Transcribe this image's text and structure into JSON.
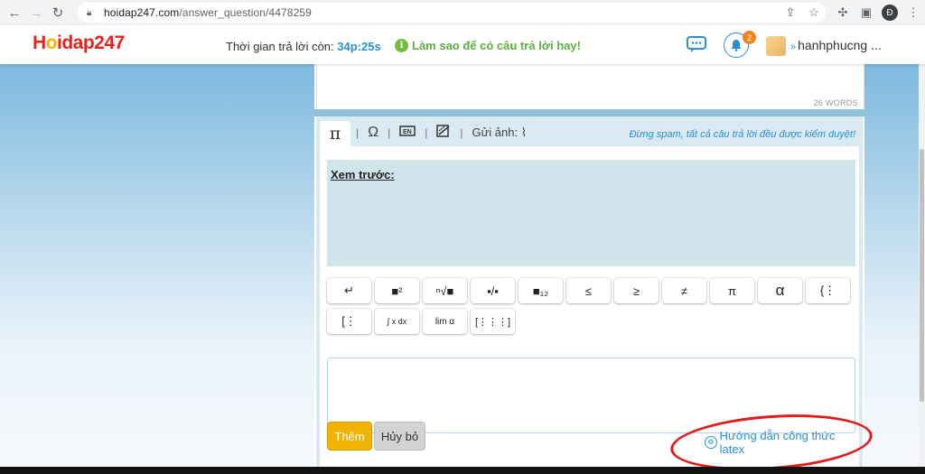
{
  "browser": {
    "url_domain": "hoidap247.com",
    "url_path": "/answer_question/4478259",
    "profile_initial": "Đ"
  },
  "header": {
    "logo_h": "H",
    "logo_o": "o",
    "logo_rest": "idap247",
    "timer_label": "Thời gian trả lời còn:",
    "timer_value": "34p:25s",
    "tip_text": "Làm sao để có câu trả lời hay!",
    "notification_count": "2",
    "username": "hanhphucng ..."
  },
  "answer": {
    "word_count": "26 WORDS"
  },
  "editor": {
    "tabs": {
      "math_symbol": "π",
      "omega_symbol": "Ω",
      "send_image_label": "Gửi ảnh:"
    },
    "spam_note": "Đừng spam, tất cả câu trả lời đều được kiểm duyệt!",
    "preview_label": "Xem trước:",
    "symbols": {
      "enter": "↵",
      "power": "■²",
      "root": "ⁿ√■",
      "fraction": "▪/▪",
      "subscript": "■₁₂",
      "leq": "≤",
      "geq": "≥",
      "neq": "≠",
      "pi": "π",
      "alpha": "α",
      "system": "{⋮",
      "bracket_system": "[⋮",
      "integral": "∫ x dx",
      "limit": "lim α",
      "matrix": "[⋮⋮⋮]"
    },
    "add_button": "Thêm",
    "cancel_button": "Hủy bỏ",
    "latex_guide": "Hướng dẫn công thức latex"
  },
  "colors": {
    "brand_red": "#e8231d",
    "accent_blue": "#2b8fd3",
    "tip_green": "#5cb040",
    "add_yellow": "#f0b400",
    "annotation_red": "#e01c1c"
  }
}
